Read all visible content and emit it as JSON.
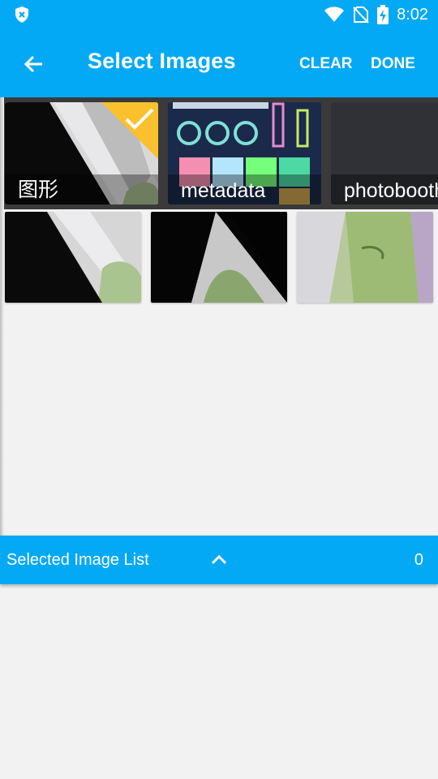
{
  "status_bar": {
    "time": "8:02"
  },
  "app_bar": {
    "title": "Select Images",
    "clear_label": "CLEAR",
    "done_label": "DONE"
  },
  "albums": [
    {
      "label": "图形",
      "selected": true
    },
    {
      "label": "metadata",
      "selected": false
    },
    {
      "label": "photobooth",
      "selected": false
    }
  ],
  "images": [
    {
      "name": "image-1"
    },
    {
      "name": "image-2"
    },
    {
      "name": "image-3"
    }
  ],
  "selected_list": {
    "label": "Selected Image List",
    "count": "0"
  },
  "colors": {
    "primary": "#03a9f4",
    "check_accent": "#fbc02d",
    "background": "#f2f2f2"
  }
}
